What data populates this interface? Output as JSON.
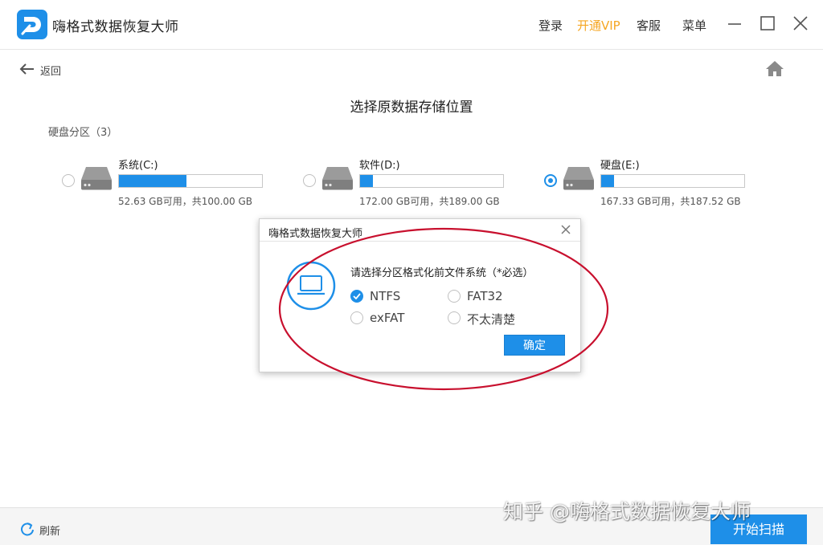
{
  "app": {
    "title": "嗨格式数据恢复大师",
    "accent_color": "#1e8fe8",
    "vip_color": "#f5a623"
  },
  "topbar": {
    "login": "登录",
    "vip": "开通VIP",
    "service": "客服",
    "menu": "菜单",
    "icons": [
      "minimize-icon",
      "maximize-icon",
      "close-icon"
    ]
  },
  "nav": {
    "back": "返回",
    "home_icon": "home-icon"
  },
  "page": {
    "title": "选择原数据存储位置",
    "section": "硬盘分区（3）"
  },
  "drives": [
    {
      "name": "系统(C:)",
      "info": "52.63 GB可用，共100.00 GB",
      "used_fraction": 0.47,
      "selected": false
    },
    {
      "name": "软件(D:)",
      "info": "172.00 GB可用，共189.00 GB",
      "used_fraction": 0.09,
      "selected": false
    },
    {
      "name": "硬盘(E:)",
      "info": "167.33 GB可用，共187.52 GB",
      "used_fraction": 0.09,
      "selected": true
    }
  ],
  "dialog": {
    "title": "嗨格式数据恢复大师",
    "prompt": "请选择分区格式化前文件系统（*必选）",
    "options": [
      {
        "label": "NTFS",
        "checked": true
      },
      {
        "label": "FAT32",
        "checked": false
      },
      {
        "label": "exFAT",
        "checked": false
      },
      {
        "label": "不太清楚",
        "checked": false
      }
    ],
    "confirm": "确定"
  },
  "footer": {
    "refresh": "刷新",
    "start": "开始扫描"
  },
  "watermark": "知乎 @嗨格式数据恢复大师",
  "annotation_color": "#c8102e"
}
